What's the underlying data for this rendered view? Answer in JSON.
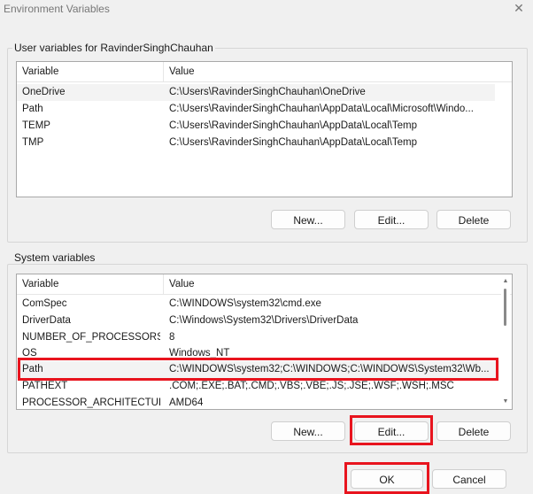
{
  "window": {
    "title": "Environment Variables",
    "close_glyph": "✕"
  },
  "user_vars": {
    "group_label": "User variables for RavinderSinghChauhan",
    "col_variable": "Variable",
    "col_value": "Value",
    "rows": [
      {
        "name": "OneDrive",
        "value": "C:\\Users\\RavinderSinghChauhan\\OneDrive"
      },
      {
        "name": "Path",
        "value": "C:\\Users\\RavinderSinghChauhan\\AppData\\Local\\Microsoft\\Windo..."
      },
      {
        "name": "TEMP",
        "value": "C:\\Users\\RavinderSinghChauhan\\AppData\\Local\\Temp"
      },
      {
        "name": "TMP",
        "value": "C:\\Users\\RavinderSinghChauhan\\AppData\\Local\\Temp"
      }
    ],
    "new_label": "New...",
    "edit_label": "Edit...",
    "delete_label": "Delete"
  },
  "system_vars": {
    "group_label": "System variables",
    "col_variable": "Variable",
    "col_value": "Value",
    "rows": [
      {
        "name": "ComSpec",
        "value": "C:\\WINDOWS\\system32\\cmd.exe"
      },
      {
        "name": "DriverData",
        "value": "C:\\Windows\\System32\\Drivers\\DriverData"
      },
      {
        "name": "NUMBER_OF_PROCESSORS",
        "value": "8"
      },
      {
        "name": "OS",
        "value": "Windows_NT"
      },
      {
        "name": "Path",
        "value": "C:\\WINDOWS\\system32;C:\\WINDOWS;C:\\WINDOWS\\System32\\Wb..."
      },
      {
        "name": "PATHEXT",
        "value": ".COM;.EXE;.BAT;.CMD;.VBS;.VBE;.JS;.JSE;.WSF;.WSH;.MSC"
      },
      {
        "name": "PROCESSOR_ARCHITECTURE",
        "value": "AMD64"
      }
    ],
    "new_label": "New...",
    "edit_label": "Edit...",
    "delete_label": "Delete"
  },
  "footer": {
    "ok_label": "OK",
    "cancel_label": "Cancel"
  },
  "colors": {
    "highlight": "#e8141e",
    "background": "#f0f0f0"
  }
}
